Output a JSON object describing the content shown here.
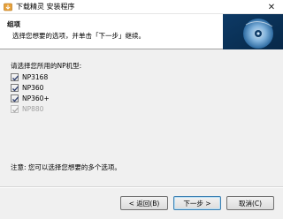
{
  "window": {
    "title": "下载精灵 安装程序",
    "close_label": "✕"
  },
  "header": {
    "title": "组项",
    "subtitle": "选择您想要的选项，并单击「下一步」继续。"
  },
  "body": {
    "prompt": "请选择您所用的NP机型:",
    "options": [
      {
        "label": "NP3168",
        "checked": true,
        "enabled": true
      },
      {
        "label": "NP360",
        "checked": true,
        "enabled": true
      },
      {
        "label": "NP360+",
        "checked": true,
        "enabled": true
      },
      {
        "label": "NP880",
        "checked": true,
        "enabled": false
      }
    ],
    "note": "注意: 您可以选择您想要的多个选项。"
  },
  "buttons": {
    "back": "< 返回(B)",
    "next": "下一步 >",
    "cancel": "取消(C)"
  }
}
